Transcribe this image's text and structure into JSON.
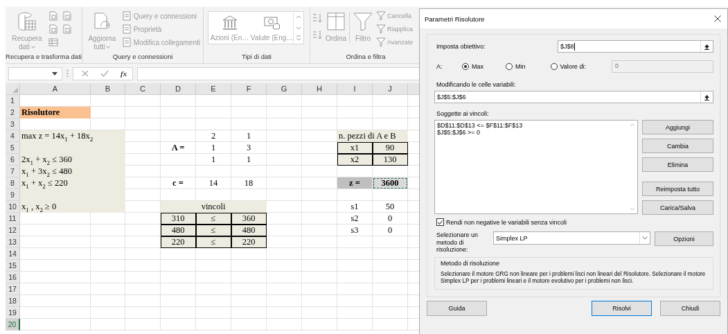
{
  "ribbon": {
    "groups": [
      {
        "kind": "get_data",
        "label": "Recupera e trasforma dati",
        "large": {
          "label": "Recupera dati",
          "dropdown": true
        }
      },
      {
        "kind": "queries",
        "label": "Query e connessioni",
        "large": {
          "label": "Aggiorna tutti",
          "dropdown": true
        },
        "small": [
          "Query e connessioni",
          "Proprietà",
          "Modifica collegamenti"
        ]
      },
      {
        "kind": "data_types",
        "label": "Tipi di dati",
        "gallery": [
          "Azioni (En…",
          "Valute (Eng…"
        ]
      },
      {
        "kind": "sort_filter",
        "label": "Ordina e filtra",
        "large": [
          "Ordina",
          "Filtro"
        ],
        "small": [
          "Cancella",
          "Riapplica",
          "Avanzate"
        ]
      }
    ]
  },
  "formula_bar": {
    "function_label": "fx"
  },
  "sheet": {
    "columns": [
      "A",
      "B",
      "C",
      "D",
      "E",
      "F",
      "G",
      "H",
      "I",
      "J"
    ],
    "rows": [
      {
        "number": "1",
        "selected": false
      },
      {
        "number": "2",
        "selected": false,
        "cells": [
          {
            "text": "Risolutore",
            "kind": "title"
          }
        ]
      },
      {
        "number": "3",
        "selected": false
      },
      {
        "number": "4",
        "selected": false,
        "cells": [
          {
            "text": "max z = 14x$_{1}$ + 18x$_{2}$",
            "kind": "note"
          },
          {
            "merged": true
          },
          {},
          {},
          {
            "text": "2"
          },
          {
            "text": "1"
          },
          {},
          {},
          {
            "text": "n. pezzi di A e B",
            "kind": "note"
          },
          {
            "merged": true
          }
        ]
      },
      {
        "number": "5",
        "selected": false,
        "cells": [
          {
            "kind": "note"
          },
          {
            "merged": true
          },
          {},
          {
            "text": "A =",
            "kind": "label"
          },
          {
            "text": "1"
          },
          {
            "text": "3"
          },
          {},
          {},
          {
            "text": "x1",
            "kind": "boxed"
          },
          {
            "text": "90",
            "kind": "boxed"
          }
        ]
      },
      {
        "number": "6",
        "selected": false,
        "cells": [
          {
            "text": "2x$_{1}$ + x$_{2}$ ≤ 360",
            "kind": "note"
          },
          {
            "merged": true
          },
          {},
          {},
          {
            "text": "1"
          },
          {
            "text": "1"
          },
          {},
          {},
          {
            "text": "x2",
            "kind": "boxed"
          },
          {
            "text": "130",
            "kind": "boxed"
          }
        ]
      },
      {
        "number": "7",
        "selected": false,
        "cells": [
          {
            "text": "x$_{1}$ + 3x$_{2}$ ≤ 480",
            "kind": "note"
          },
          {
            "merged": true
          }
        ]
      },
      {
        "number": "8",
        "selected": false,
        "cells": [
          {
            "text": "x$_{1}$ + x$_{2}$ ≤ 220",
            "kind": "note"
          },
          {
            "merged": true
          },
          {},
          {
            "text": "c =",
            "kind": "label"
          },
          {
            "text": "14"
          },
          {
            "text": "18"
          },
          {},
          {},
          {
            "text": "z =",
            "kind": "total_label"
          },
          {
            "text": "3600",
            "kind": "total"
          }
        ]
      },
      {
        "number": "9",
        "selected": false,
        "cells": [
          {
            "kind": "note"
          },
          {
            "merged": true
          }
        ]
      },
      {
        "number": "10",
        "selected": false,
        "cells": [
          {
            "text": "x$_{1}$ , x$_{2}$ ≥ 0",
            "kind": "note"
          },
          {
            "merged": true
          },
          {},
          {
            "text": "vincoli",
            "kind": "heading"
          },
          {
            "merged": true
          },
          {
            "merged": true
          },
          {},
          {},
          {
            "text": "s1"
          },
          {
            "text": "50"
          }
        ]
      },
      {
        "number": "11",
        "selected": false,
        "cells": [
          {},
          {},
          {},
          {
            "text": "310",
            "kind": "boxed"
          },
          {
            "text": "≤",
            "kind": "boxed"
          },
          {
            "text": "360",
            "kind": "boxed"
          },
          {},
          {},
          {
            "text": "s2"
          },
          {
            "text": "0"
          }
        ]
      },
      {
        "number": "12",
        "selected": false,
        "cells": [
          {},
          {},
          {},
          {
            "text": "480",
            "kind": "boxed"
          },
          {
            "text": "≤",
            "kind": "boxed"
          },
          {
            "text": "480",
            "kind": "boxed"
          },
          {},
          {},
          {
            "text": "s3"
          },
          {
            "text": "0"
          }
        ]
      },
      {
        "number": "13",
        "selected": false,
        "cells": [
          {},
          {},
          {},
          {
            "text": "220",
            "kind": "boxed"
          },
          {
            "text": "≤",
            "kind": "boxed"
          },
          {
            "text": "220",
            "kind": "boxed"
          }
        ]
      },
      {
        "number": "14",
        "selected": false
      },
      {
        "number": "15",
        "selected": false
      },
      {
        "number": "16",
        "selected": false
      },
      {
        "number": "17",
        "selected": false
      },
      {
        "number": "18",
        "selected": false
      },
      {
        "number": "19",
        "selected": false
      },
      {
        "number": "20",
        "selected": true
      }
    ]
  },
  "dialog": {
    "title": "Parametri Risolutore",
    "objective": {
      "label": "Imposta obiettivo:",
      "value": "$J$8"
    },
    "target": {
      "label": "A:",
      "options": [
        {
          "label": "Max",
          "selected": true
        },
        {
          "label": "Min",
          "selected": false
        },
        {
          "label": "Valore di:",
          "selected": false
        }
      ],
      "value": "0",
      "disabled": true
    },
    "variables": {
      "label": "Modificando le celle variabili:",
      "value": "$J$5:$J$6"
    },
    "constraints": {
      "label": "Soggette ai vincoli:",
      "items": [
        "$D$11:$D$13 <= $F$11:$F$13",
        "$J$5:$J$6 >= 0"
      ]
    },
    "side_buttons": [
      "Aggiungi",
      "Cambia",
      "Elimina",
      "Reimposta tutto",
      "Carica/Salva"
    ],
    "nonnegative": {
      "label": "Rendi non negative le variabili senza vincoli",
      "checked": true
    },
    "method": {
      "label": "Selezionare un metodo di risoluzione:",
      "value": "Simplex LP",
      "button": "Opzioni"
    },
    "method_info": {
      "title": "Metodo di risoluzione",
      "text": "Selezionare il motore GRG non lineare per i problemi lisci non lineari del Risolutore. Selezionare il motore Simplex LP per i problemi lineari e il motore evolutivo per i problemi non lisci."
    },
    "footer_buttons": [
      {
        "label": "Guida",
        "default": false
      },
      {
        "label": "Risolvi",
        "default": true
      },
      {
        "label": "Chiudi",
        "default": false
      }
    ]
  }
}
